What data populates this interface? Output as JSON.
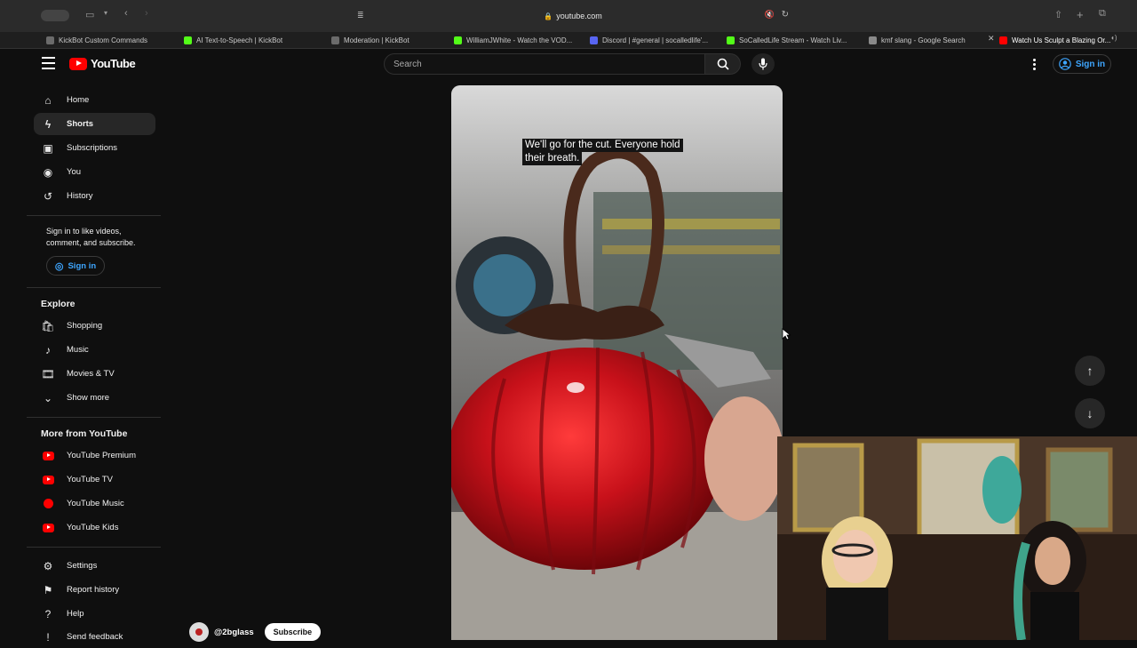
{
  "browser": {
    "url": "youtube.com",
    "tabs": [
      {
        "label": "KickBot Custom Commands",
        "color": "#6b6b6b"
      },
      {
        "label": "AI Text-to-Speech | KickBot",
        "color": "#53fc18"
      },
      {
        "label": "Moderation | KickBot",
        "color": "#6b6b6b"
      },
      {
        "label": "WilliamJWhite - Watch the VOD...",
        "color": "#53fc18"
      },
      {
        "label": "Discord | #general | socalledlife'...",
        "color": "#5865f2"
      },
      {
        "label": "SoCalledLife Stream - Watch Liv...",
        "color": "#53fc18"
      },
      {
        "label": "kmf slang - Google Search",
        "color": "#8a8a8a"
      },
      {
        "label": "Watch Us Sculpt a Blazing Or...",
        "color": "#ff0000"
      }
    ]
  },
  "header": {
    "logo_text": "YouTube",
    "search_placeholder": "Search",
    "sign_in": "Sign in"
  },
  "sidebar": {
    "main": [
      "Home",
      "Shorts",
      "Subscriptions",
      "You",
      "History"
    ],
    "signin_prompt": "Sign in to like videos, comment, and subscribe.",
    "signin_button": "Sign in",
    "explore_title": "Explore",
    "explore": [
      "Shopping",
      "Music",
      "Movies & TV",
      "Show more"
    ],
    "more_title": "More from YouTube",
    "more": [
      "YouTube Premium",
      "YouTube TV",
      "YouTube Music",
      "YouTube Kids"
    ],
    "footer": [
      "Settings",
      "Report history",
      "Help",
      "Send feedback"
    ]
  },
  "short": {
    "caption_line1": "We'll go for the cut. Everyone hold",
    "caption_line2": "their breath.",
    "channel": "@2bglass",
    "subscribe": "Subscribe"
  }
}
